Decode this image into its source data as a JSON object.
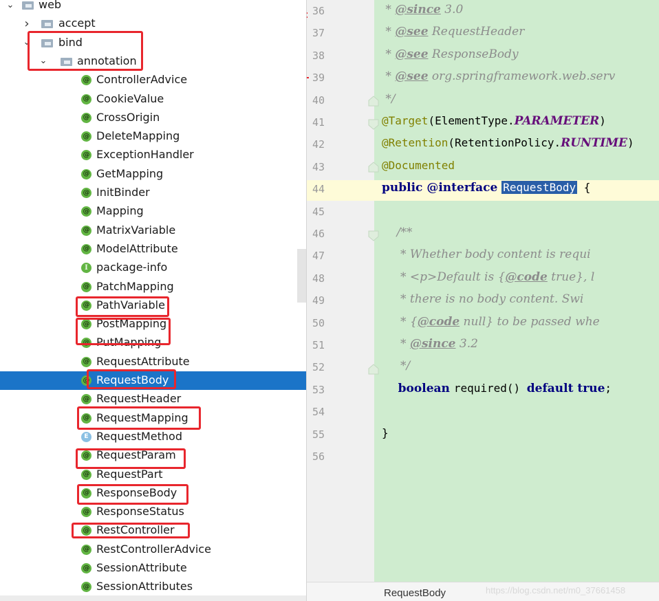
{
  "tree": {
    "nodes": [
      {
        "label": "web",
        "kind": "folder",
        "arrow": "expanded",
        "indent": 0
      },
      {
        "label": "accept",
        "kind": "folder",
        "arrow": "collapsed",
        "indent": 1
      },
      {
        "label": "bind",
        "kind": "folder",
        "arrow": "expanded",
        "indent": 1
      },
      {
        "label": "annotation",
        "kind": "folder",
        "arrow": "expanded",
        "indent": 2
      },
      {
        "label": "ControllerAdvice",
        "kind": "annotation"
      },
      {
        "label": "CookieValue",
        "kind": "annotation"
      },
      {
        "label": "CrossOrigin",
        "kind": "annotation"
      },
      {
        "label": "DeleteMapping",
        "kind": "annotation"
      },
      {
        "label": "ExceptionHandler",
        "kind": "annotation"
      },
      {
        "label": "GetMapping",
        "kind": "annotation"
      },
      {
        "label": "InitBinder",
        "kind": "annotation"
      },
      {
        "label": "Mapping",
        "kind": "annotation"
      },
      {
        "label": "MatrixVariable",
        "kind": "annotation"
      },
      {
        "label": "ModelAttribute",
        "kind": "annotation"
      },
      {
        "label": "package-info",
        "kind": "package-info"
      },
      {
        "label": "PatchMapping",
        "kind": "annotation"
      },
      {
        "label": "PathVariable",
        "kind": "annotation"
      },
      {
        "label": "PostMapping",
        "kind": "annotation"
      },
      {
        "label": "PutMapping",
        "kind": "annotation"
      },
      {
        "label": "RequestAttribute",
        "kind": "annotation"
      },
      {
        "label": "RequestBody",
        "kind": "annotation",
        "selected": true
      },
      {
        "label": "RequestHeader",
        "kind": "annotation"
      },
      {
        "label": "RequestMapping",
        "kind": "annotation"
      },
      {
        "label": "RequestMethod",
        "kind": "enum"
      },
      {
        "label": "RequestParam",
        "kind": "annotation"
      },
      {
        "label": "RequestPart",
        "kind": "annotation"
      },
      {
        "label": "ResponseBody",
        "kind": "annotation"
      },
      {
        "label": "ResponseStatus",
        "kind": "annotation"
      },
      {
        "label": "RestController",
        "kind": "annotation"
      },
      {
        "label": "RestControllerAdvice",
        "kind": "annotation"
      },
      {
        "label": "SessionAttribute",
        "kind": "annotation"
      },
      {
        "label": "SessionAttributes",
        "kind": "annotation"
      }
    ],
    "icons": {
      "annotation": "@",
      "package-info": "I",
      "enum": "E"
    }
  },
  "editor": {
    "lines": [
      {
        "n": "36",
        "html": "<span class=\"doc\"> * </span><span class=\"tag\">@since</span><span class=\"doc\"> 3.0</span>"
      },
      {
        "n": "37",
        "html": "<span class=\"doc\"> * </span><span class=\"tag\">@see</span><span class=\"ref\"> RequestHeader</span>"
      },
      {
        "n": "38",
        "html": "<span class=\"doc\"> * </span><span class=\"tag\">@see</span><span class=\"ref\"> ResponseBody</span>"
      },
      {
        "n": "39",
        "html": "<span class=\"doc\"> * </span><span class=\"tag\">@see</span><span class=\"doc\"> org.springframework.web.serv</span>"
      },
      {
        "n": "40",
        "html": "<span class=\"doc\"> */</span>"
      },
      {
        "n": "41",
        "html": "<span class=\"ann\">@Target</span><span class=\"mono\">(ElementType.</span><span class=\"const\">PARAMETER</span><span class=\"mono\">)</span>"
      },
      {
        "n": "42",
        "html": "<span class=\"ann\">@Retention</span><span class=\"mono\">(RetentionPolicy.</span><span class=\"const\">RUNTIME</span><span class=\"mono\">)</span>"
      },
      {
        "n": "43",
        "html": "<span class=\"ann\">@Documented</span>"
      },
      {
        "n": "44",
        "html": "<span class=\"kw\">public </span><span class=\"kw\">@interface </span><span class=\"sel-ident\">RequestBody</span><span class=\"mono\"> {</span>"
      },
      {
        "n": "45",
        "html": ""
      },
      {
        "n": "46",
        "html": "<span class=\"doc\">    /**</span>"
      },
      {
        "n": "47",
        "html": "<span class=\"doc\">     * Whether body content is requi</span>"
      },
      {
        "n": "48",
        "html": "<span class=\"doc\">     * &lt;p&gt;Default is {</span><span class=\"tag\">@code</span><span class=\"doc\"> true}, l</span>"
      },
      {
        "n": "49",
        "html": "<span class=\"doc\">     * there is no body content. Swi</span>"
      },
      {
        "n": "50",
        "html": "<span class=\"doc\">     * {</span><span class=\"tag\">@code</span><span class=\"doc\"> null} to be passed whe</span>"
      },
      {
        "n": "51",
        "html": "<span class=\"doc\">     * </span><span class=\"tag\">@since</span><span class=\"doc\"> 3.2</span>"
      },
      {
        "n": "52",
        "html": "<span class=\"doc\">     */</span>"
      },
      {
        "n": "53",
        "html": "<span class=\"kw\">    boolean </span><span class=\"mono\">required() </span><span class=\"kw\">default true</span><span class=\"mono\">;</span>"
      },
      {
        "n": "54",
        "html": ""
      },
      {
        "n": "55",
        "html": "<span class=\"mono\">}</span>"
      },
      {
        "n": "56",
        "html": ""
      }
    ],
    "breadcrumb": "RequestBody",
    "watermark": "https://blog.csdn.net/m0_37661458"
  },
  "colors": {
    "selection": "#1b74c8",
    "highlight_box": "#e8262d",
    "code_bg": "#cfeccf"
  }
}
